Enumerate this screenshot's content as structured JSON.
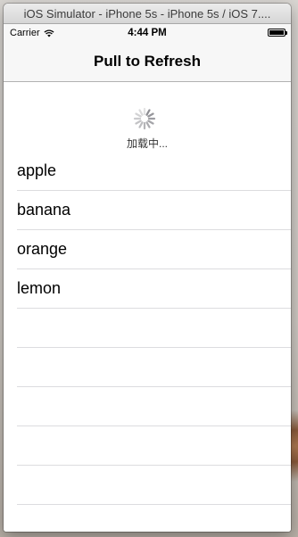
{
  "window": {
    "title": "iOS Simulator - iPhone 5s - iPhone 5s / iOS 7...."
  },
  "statusbar": {
    "carrier": "Carrier",
    "time": "4:44 PM",
    "wifi_icon": "wifi-icon",
    "battery_icon": "battery-icon",
    "battery_level": 1.0
  },
  "navbar": {
    "title": "Pull to Refresh"
  },
  "refresh": {
    "label": "加载中...",
    "spinner_icon": "activity-spinner-icon"
  },
  "list": {
    "items": [
      "apple",
      "banana",
      "orange",
      "lemon"
    ],
    "empty_rows": 5
  }
}
